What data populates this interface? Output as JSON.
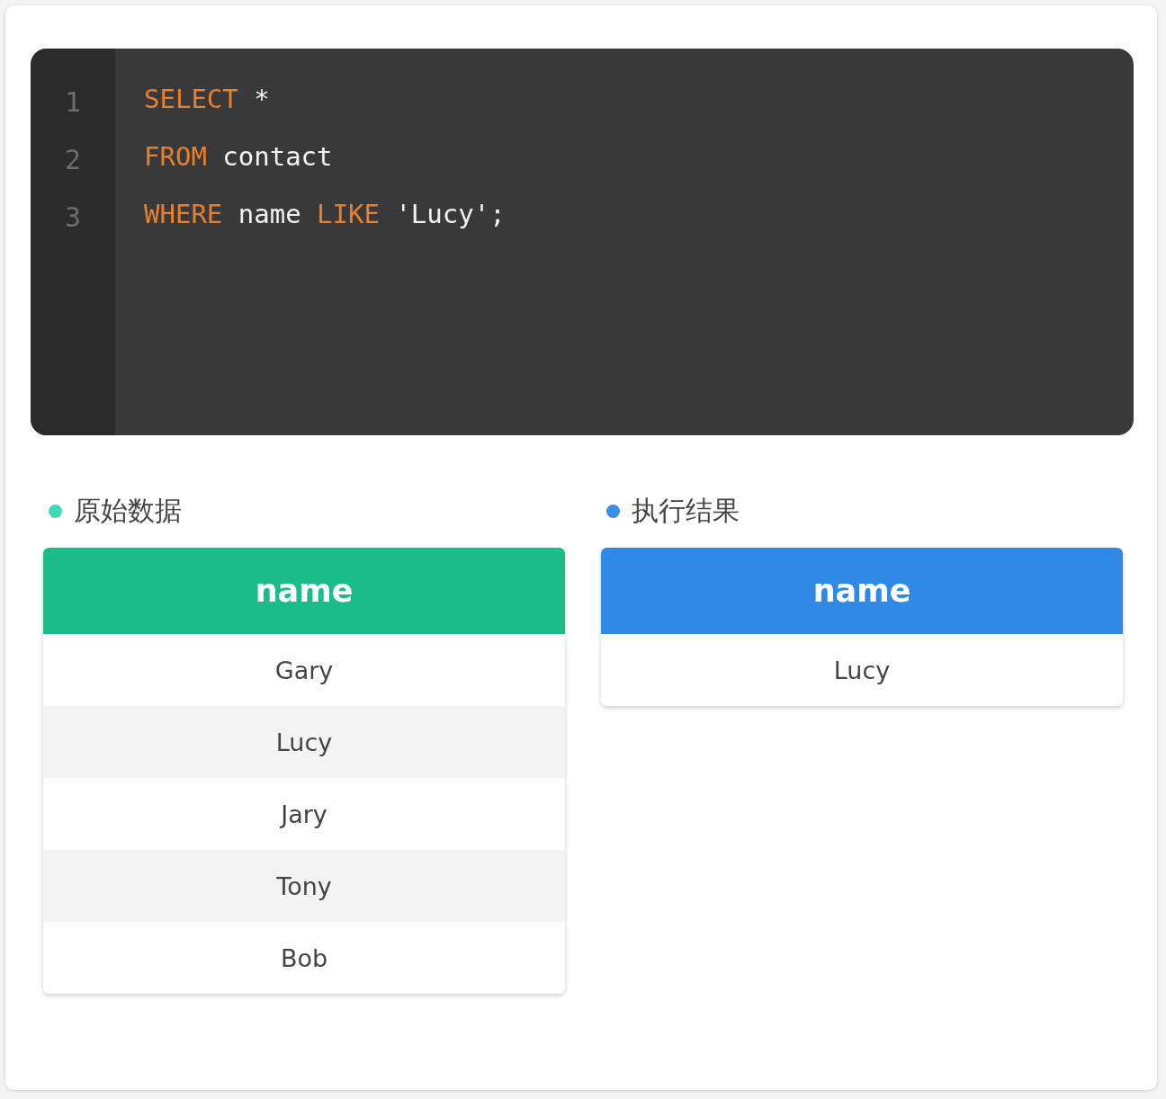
{
  "editor": {
    "lines": [
      {
        "number": "1",
        "tokens": [
          {
            "text": "SELECT",
            "kind": "keyword"
          },
          {
            "text": " *",
            "kind": "plain"
          }
        ]
      },
      {
        "number": "2",
        "tokens": [
          {
            "text": "FROM",
            "kind": "keyword"
          },
          {
            "text": " contact",
            "kind": "plain"
          }
        ]
      },
      {
        "number": "3",
        "tokens": [
          {
            "text": "WHERE",
            "kind": "keyword"
          },
          {
            "text": " name ",
            "kind": "plain"
          },
          {
            "text": "LIKE",
            "kind": "keyword"
          },
          {
            "text": " 'Lucy';",
            "kind": "plain"
          }
        ]
      }
    ]
  },
  "panels": [
    {
      "title": "原始数据",
      "color": "#3fd9b5",
      "kind": "source",
      "columns": [
        "name"
      ],
      "rows": [
        [
          "Gary"
        ],
        [
          "Lucy"
        ],
        [
          "Jary"
        ],
        [
          "Tony"
        ],
        [
          "Bob"
        ]
      ]
    },
    {
      "title": "执行结果",
      "color": "#3a8ee6",
      "kind": "result",
      "columns": [
        "name"
      ],
      "rows": [
        [
          "Lucy"
        ]
      ]
    }
  ]
}
